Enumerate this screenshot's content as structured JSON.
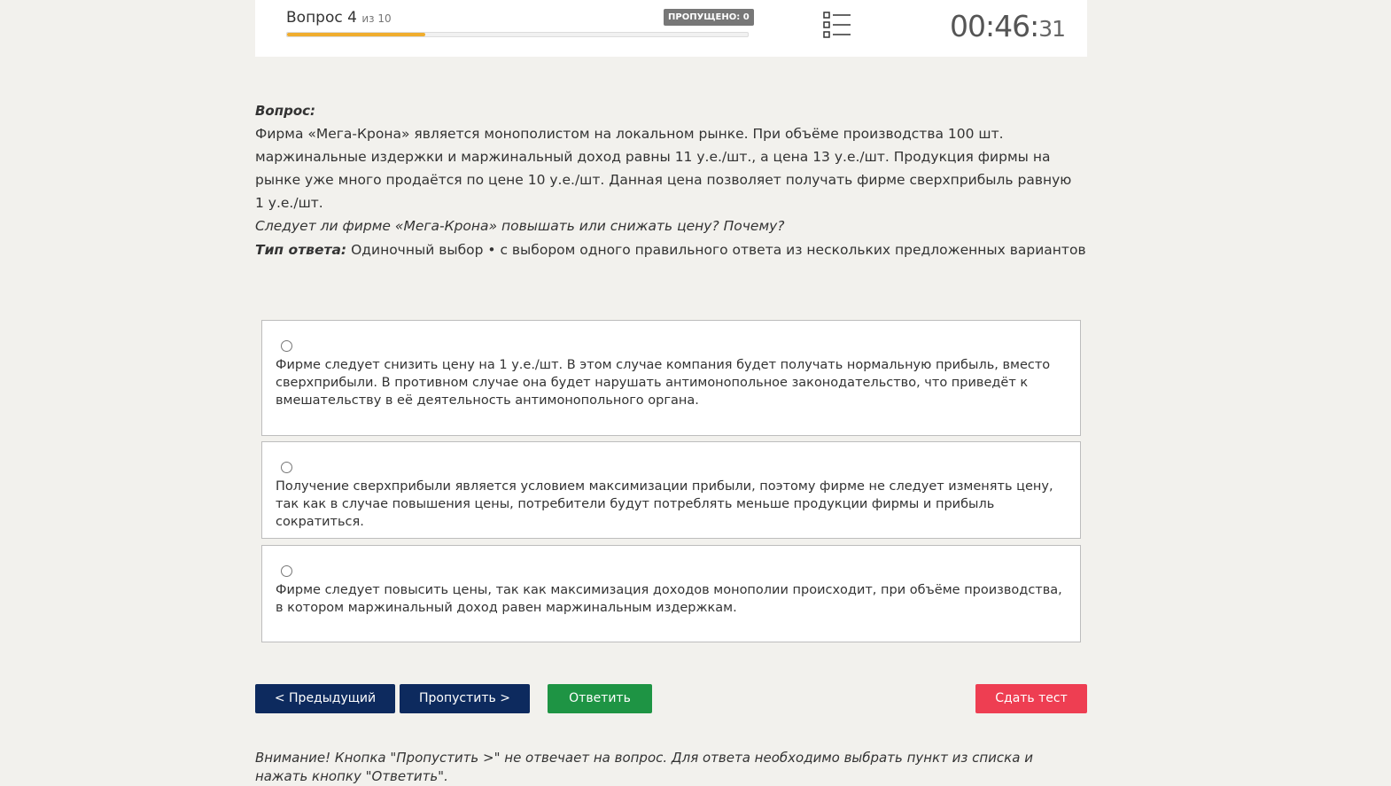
{
  "header": {
    "question_word": "Вопрос",
    "question_current": "4",
    "question_of": "из 10",
    "progress_fraction": 0.3,
    "skipped_label": "ПРОПУЩЕНО: 0",
    "list_icon": "list-icon",
    "timer_main": "00:46:",
    "timer_seconds": "31"
  },
  "question": {
    "label": "Вопрос:",
    "body": "Фирма «Мега-Крона» является монополистом на локальном рынке. При объёме производства 100 шт. маржинальные издержки и маржинальный доход равны 11 у.е./шт., а цена 13 у.е./шт. Продукция фирмы на рынке уже много продаётся по цене 10 у.е./шт. Данная цена позволяет получать фирме сверхприбыль равную 1 у.е./шт.",
    "ask": "Следует ли фирме «Мега-Крона» повышать или снижать цену? Почему?"
  },
  "answer_type": {
    "label": "Тип ответа:",
    "value": "Одиночный выбор • с выбором одного правильного ответа из нескольких предложенных вариантов"
  },
  "options": [
    {
      "text": "Фирме следует снизить цену на 1 у.е./шт. В этом случае компания будет получать нормальную прибыль, вместо сверхприбыли. В противном случае она будет нарушать антимонопольное законодательство, что приведёт к вмешательству в её деятельность антимонопольного органа."
    },
    {
      "text": "Получение сверхприбыли является условием максимизации прибыли, поэтому фирме не следует изменять цену, так как в случае повышения цены, потребители будут потреблять меньше продукции фирмы и прибыль сократиться."
    },
    {
      "text": "Фирме следует повысить цены, так как максимизация доходов монополии происходит, при объёме производства, в котором маржинальный доход равен маржинальным издержкам."
    }
  ],
  "buttons": {
    "prev": "< Предыдущий",
    "skip": "Пропустить >",
    "answer": "Ответить",
    "finish": "Сдать тест"
  },
  "notice": "Внимание! Кнопка \"Пропустить >\" не отвечает на вопрос. Для ответа необходимо выбрать пункт из списка и нажать кнопку \"Ответить\".",
  "colors": {
    "progress": "#f0ad2e",
    "nav_button": "#0d2a5e",
    "answer_button": "#1e9444",
    "finish_button": "#ee3e52",
    "badge": "#777777"
  }
}
